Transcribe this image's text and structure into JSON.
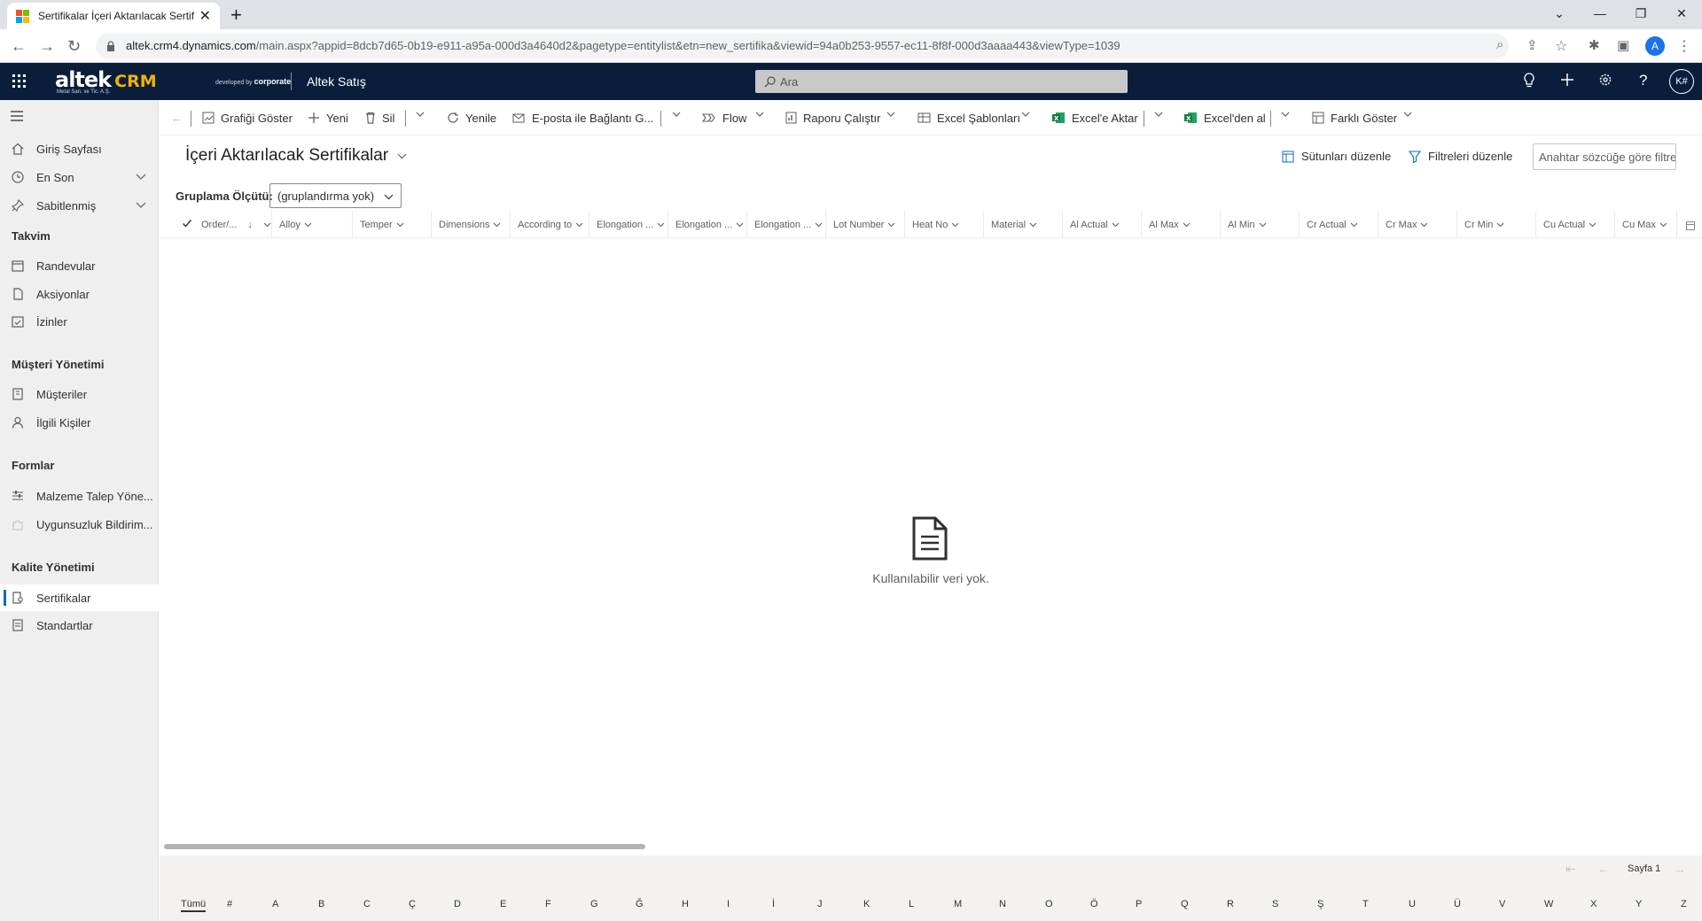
{
  "browser": {
    "tab_title": "Sertifikalar İçeri Aktarılacak Sertif",
    "url_host": "altek.crm4.dynamics.com",
    "url_path": "/main.aspx?appid=8dcb7d65-0b19-e911-a95a-000d3a4640d2&pagetype=entitylist&etn=new_sertifika&viewid=94a0b253-9557-ec11-8f8f-000d3aaaa443&viewType=1039",
    "profile_initial": "A"
  },
  "header": {
    "logo_text": "altek",
    "logo_crm": "CRM",
    "logo_sub": "Metal San. ve Tic. A.Ş.",
    "developed_by": "developed by",
    "developer": "corporate",
    "app_name": "Altek Satış",
    "search_placeholder": "Ara",
    "user_initials": "K#"
  },
  "sidebar": {
    "items": [
      {
        "label": "Giriş Sayfası"
      },
      {
        "label": "En Son"
      },
      {
        "label": "Sabitlenmiş"
      }
    ],
    "groups": [
      {
        "title": "Takvim",
        "items": [
          {
            "label": "Randevular"
          },
          {
            "label": "Aksiyonlar"
          },
          {
            "label": "İzinler"
          }
        ]
      },
      {
        "title": "Müşteri Yönetimi",
        "items": [
          {
            "label": "Müşteriler"
          },
          {
            "label": "İlgili Kişiler"
          }
        ]
      },
      {
        "title": "Formlar",
        "items": [
          {
            "label": "Malzeme Talep Yöne..."
          },
          {
            "label": "Uygunsuzluk Bildirim..."
          }
        ]
      },
      {
        "title": "Kalite Yönetimi",
        "items": [
          {
            "label": "Sertifikalar"
          },
          {
            "label": "Standartlar"
          }
        ]
      }
    ]
  },
  "commandbar": {
    "show_chart": "Grafiği Göster",
    "new": "Yeni",
    "delete": "Sil",
    "refresh": "Yenile",
    "email_link": "E-posta ile Bağlantı G...",
    "flow": "Flow",
    "run_report": "Raporu Çalıştır",
    "excel_templates": "Excel Şablonları",
    "export_excel": "Excel'e Aktar",
    "import_excel": "Excel'den al",
    "show_as": "Farklı Göster"
  },
  "view": {
    "title": "İçeri Aktarılacak Sertifikalar",
    "edit_columns": "Sütunları düzenle",
    "edit_filters": "Filtreleri düzenle",
    "keyword_placeholder": "Anahtar sözcüğe göre filtrele",
    "group_label": "Gruplama Ölçütü:",
    "group_value": "(gruplandırma yok)"
  },
  "columns": [
    "Order/...",
    "Alloy",
    "Temper",
    "Dimensions",
    "According to",
    "Elongation ...",
    "Elongation ...",
    "Elongation ...",
    "Lot Number",
    "Heat No",
    "Material",
    "Al Actual",
    "Al Max",
    "Al Min",
    "Cr Actual",
    "Cr Max",
    "Cr Min",
    "Cu Actual",
    "Cu Max"
  ],
  "empty_message": "Kullanılabilir veri yok.",
  "pager": {
    "page_label": "Sayfa 1"
  },
  "jumpbar": [
    "Tümü",
    "#",
    "A",
    "B",
    "C",
    "Ç",
    "D",
    "E",
    "F",
    "G",
    "Ğ",
    "H",
    "I",
    "İ",
    "J",
    "K",
    "L",
    "M",
    "N",
    "O",
    "Ö",
    "P",
    "Q",
    "R",
    "S",
    "Ş",
    "T",
    "U",
    "Ü",
    "V",
    "W",
    "X",
    "Y",
    "Z"
  ]
}
